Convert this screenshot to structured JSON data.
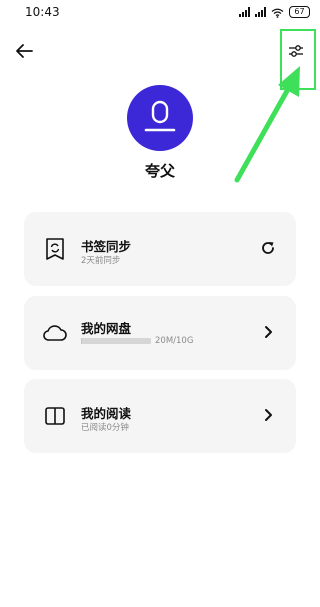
{
  "status_bar": {
    "time": "10:43",
    "battery": "67",
    "icons": [
      "signal-icon",
      "signal-icon",
      "wifi-icon",
      "battery-icon"
    ]
  },
  "header": {
    "back_icon": "arrow-left-icon",
    "settings_icon": "sliders-icon"
  },
  "profile": {
    "avatar_color": "#3d28d8",
    "username": "夸父"
  },
  "cards": [
    {
      "title": "书签同步",
      "subtitle": "2天前同步",
      "icon": "bookmark-sync-icon",
      "action_icon": "refresh-icon"
    },
    {
      "title": "我的网盘",
      "storage": "20M/10G",
      "usage_fraction": 0.002,
      "icon": "cloud-icon",
      "action_icon": "chevron-right-icon"
    },
    {
      "title": "我的阅读",
      "subtitle": "已阅读0分钟",
      "icon": "book-icon",
      "action_icon": "chevron-right-icon"
    }
  ],
  "annotation": {
    "color": "#3ee05a"
  }
}
